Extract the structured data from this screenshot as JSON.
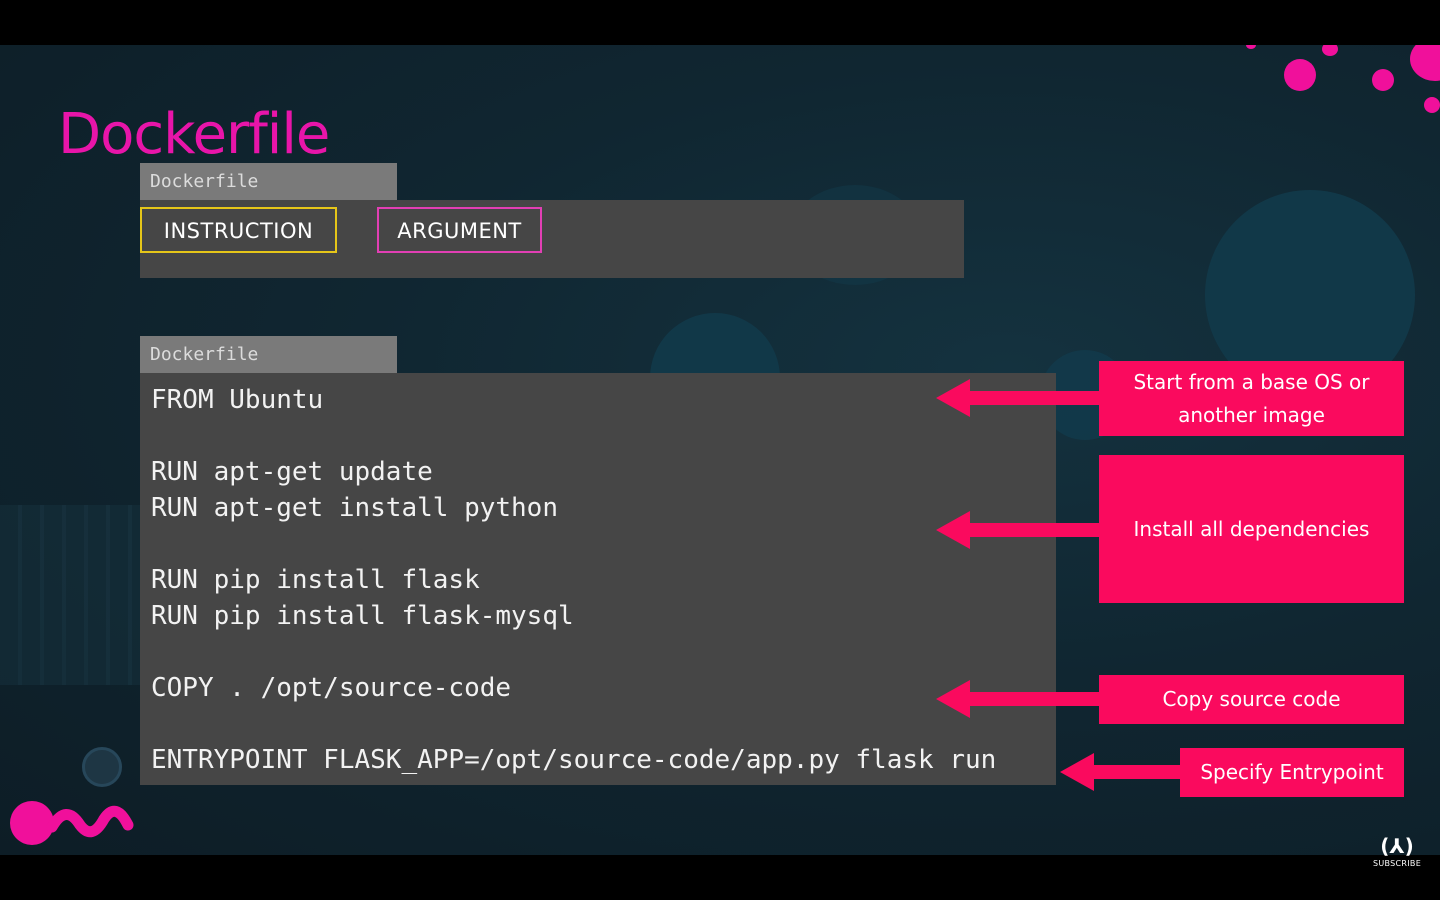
{
  "slide": {
    "title": "Dockerfile",
    "syntax_example": {
      "file_tab": "Dockerfile",
      "instruction_label": "INSTRUCTION",
      "argument_label": "ARGUMENT"
    },
    "code_example": {
      "file_tab": "Dockerfile",
      "lines": [
        "FROM Ubuntu",
        "RUN apt-get update",
        "RUN apt-get install python",
        "RUN pip install flask",
        "RUN pip install flask-mysql",
        "COPY . /opt/source-code",
        "ENTRYPOINT FLASK_APP=/opt/source-code/app.py flask run"
      ]
    },
    "callouts": [
      {
        "text": "Start from a base OS or another image"
      },
      {
        "text": "Install all dependencies"
      },
      {
        "text": "Copy source code"
      },
      {
        "text": "Specify Entrypoint"
      }
    ]
  },
  "logo": {
    "icon": "freecodecamp-logo-icon",
    "mark": "(⅄)",
    "label": "SUBSCRIBE"
  },
  "colors": {
    "title": "#e815a9",
    "callout": "#fa0a5e",
    "instruction_border": "#e6c619",
    "argument_border": "#e23fb4",
    "panel": "#464646",
    "file_tab": "#7a7a7a",
    "background": "#102631"
  }
}
